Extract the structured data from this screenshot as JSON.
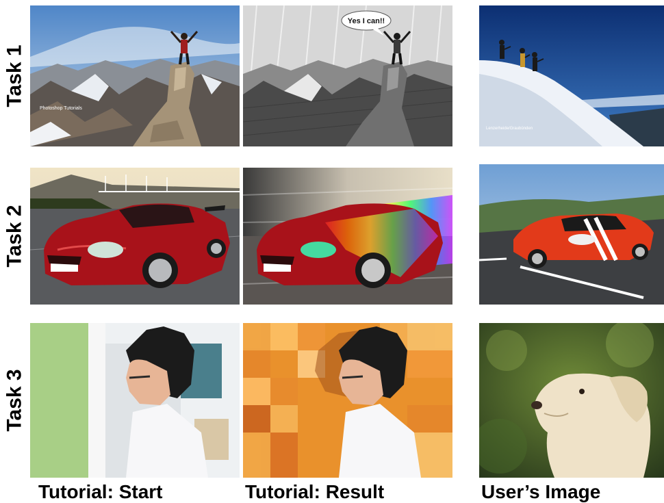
{
  "rows": [
    {
      "label": "Task 1"
    },
    {
      "label": "Task 2"
    },
    {
      "label": "Task 3"
    }
  ],
  "columns": [
    {
      "caption": "Tutorial: Start"
    },
    {
      "caption": "Tutorial: Result"
    },
    {
      "caption": "User’s Image"
    }
  ],
  "images": {
    "task1_start": {
      "watermark": "Photoshop Tutorials"
    },
    "task1_result": {
      "speech_bubble": "Yes I can!!"
    },
    "task1_user": {
      "watermark": "Lenzerheide/Graubünden"
    }
  },
  "colors": {
    "sky_blue": "#6f9fd4",
    "deep_blue": "#0f3d8c",
    "car_red": "#a8121a",
    "orange": "#e9912c",
    "green": "#a8cf86"
  }
}
